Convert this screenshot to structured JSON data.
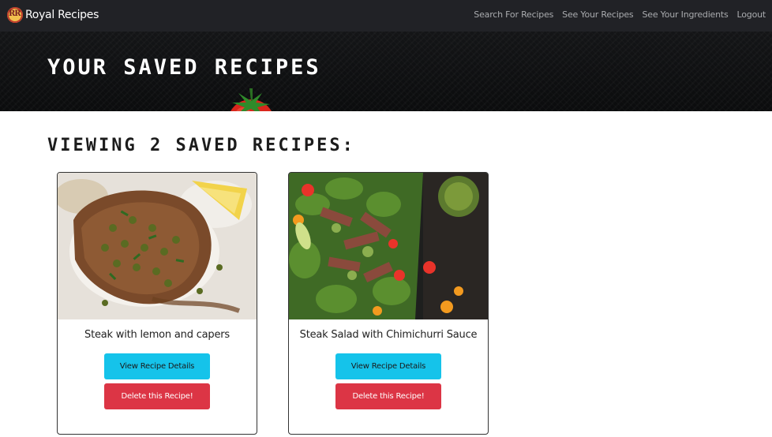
{
  "navbar": {
    "brand": "Royal Recipes",
    "brand_logo_text": "RR",
    "links": [
      "Search For Recipes",
      "See Your Recipes",
      "See Your Ingredients",
      "Logout"
    ]
  },
  "hero": {
    "title": "YOUR SAVED RECIPES"
  },
  "main": {
    "heading": "VIEWING 2 SAVED RECIPES:",
    "recipes": [
      {
        "title": "Steak with lemon and capers",
        "view_label": "View Recipe Details",
        "delete_label": "Delete this Recipe!"
      },
      {
        "title": "Steak Salad with Chimichurri Sauce",
        "view_label": "View Recipe Details",
        "delete_label": "Delete this Recipe!"
      }
    ]
  },
  "colors": {
    "navbar_bg": "#212226",
    "view_button": "#15c3ea",
    "delete_button": "#dc3545"
  }
}
